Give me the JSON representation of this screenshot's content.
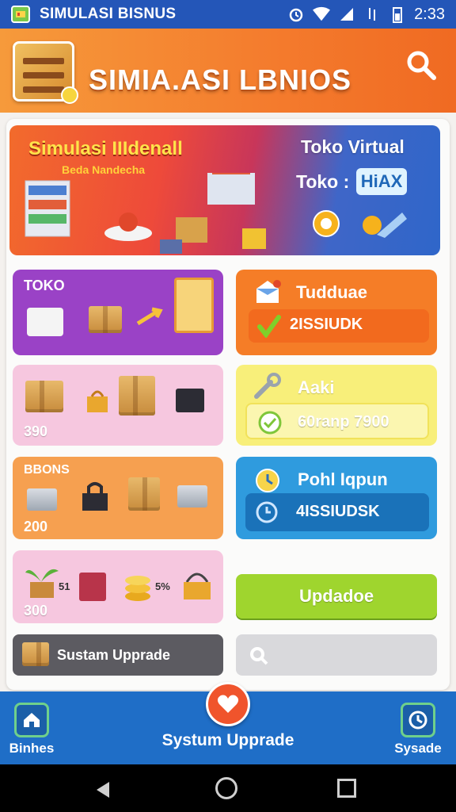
{
  "status_bar": {
    "app_name": "SIMULASI BISNUS",
    "time": "2:33"
  },
  "header": {
    "title": "SIMIA.ASI LBNIOS"
  },
  "banner": {
    "title": "Simulasi IIIdenall",
    "subtitle": "Beda Nandecha",
    "right_title": "Toko Virtual",
    "right_toko_label": "Toko :",
    "right_badge": "HiAX"
  },
  "tiles": {
    "toko": {
      "label": "TOKO"
    },
    "tudduae": {
      "label": "Tudduae",
      "value": "2ISSIUDK"
    },
    "pink1": {
      "value": "390"
    },
    "aaki": {
      "label": "Aaki",
      "value": "60ranp 7900"
    },
    "orange": {
      "label": "BBONS",
      "value": "200"
    },
    "blue": {
      "label": "Pohl Iqpun",
      "value": "4ISSIUDSK"
    },
    "pink2": {
      "value": "300",
      "tag1": "51",
      "tag2": "5%"
    }
  },
  "buttons": {
    "update": "Updadoe",
    "system_upgrade": "Sustam Upprade"
  },
  "bottom_nav": {
    "left": "Binhes",
    "center": "Systum Upprade",
    "right": "Sysade"
  },
  "colors": {
    "primary_blue": "#1f6ec7",
    "header_orange": "#f47b2d",
    "purple": "#9a42c6",
    "green": "#9fd52e"
  }
}
